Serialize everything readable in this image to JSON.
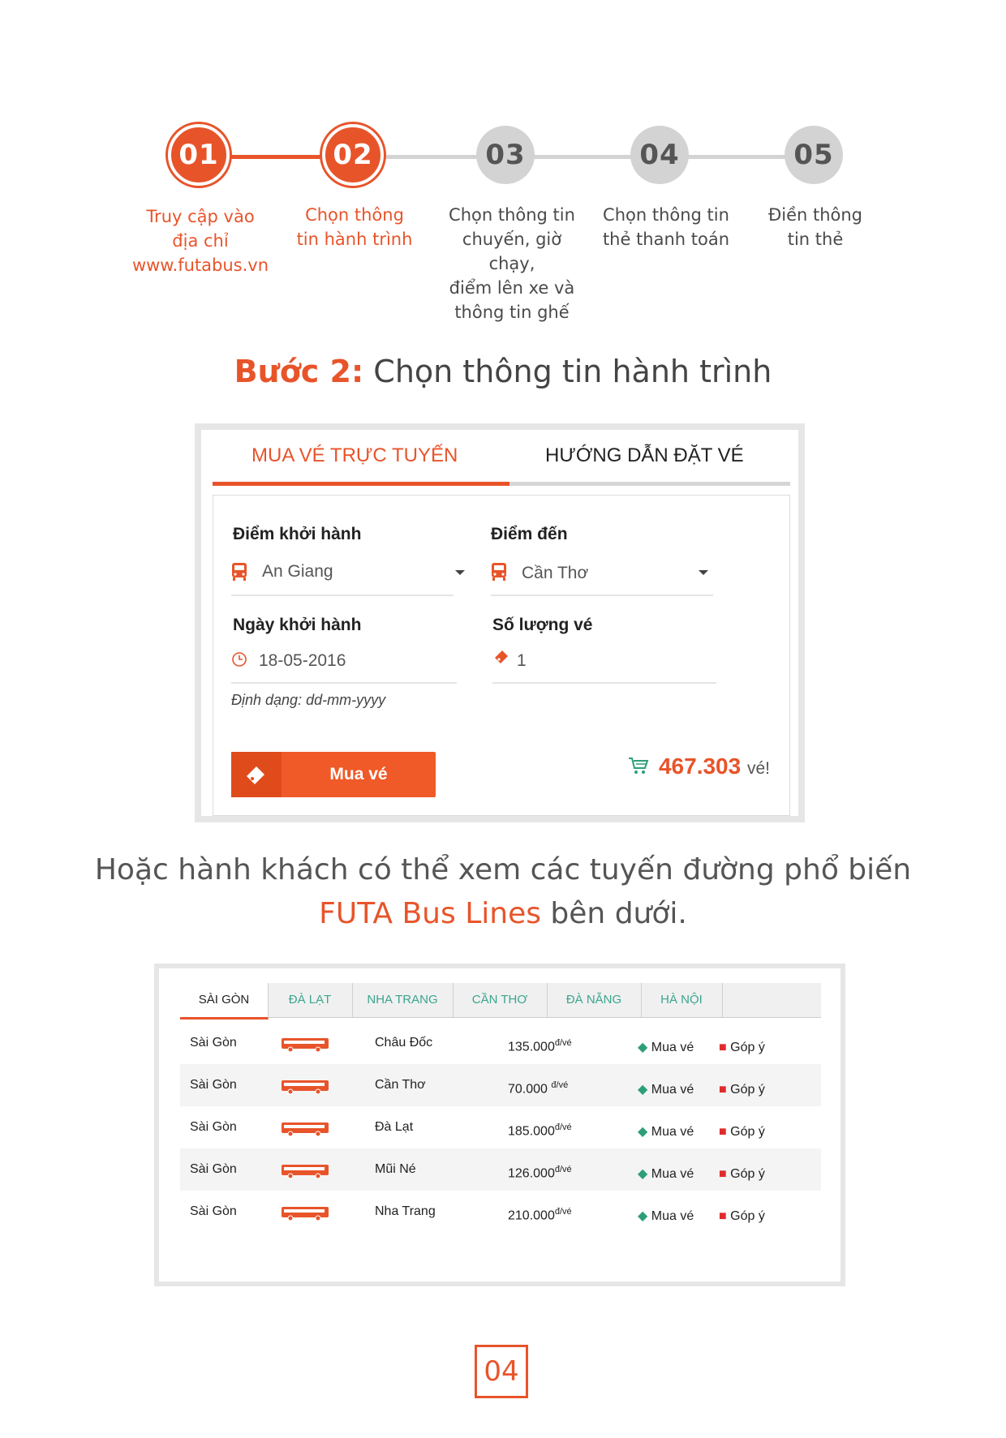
{
  "steps": [
    {
      "num": "01",
      "lines": [
        "Truy cập vào",
        "địa chỉ",
        "www.futabus.vn"
      ]
    },
    {
      "num": "02",
      "lines": [
        "Chọn thông",
        "tin hành trình"
      ]
    },
    {
      "num": "03",
      "lines": [
        "Chọn thông tin",
        "chuyến, giờ chạy,",
        "điểm lên xe và",
        "thông tin ghế"
      ]
    },
    {
      "num": "04",
      "lines": [
        "Chọn thông tin",
        "thẻ thanh toán"
      ]
    },
    {
      "num": "05",
      "lines": [
        "Điền thông",
        "tin thẻ"
      ]
    }
  ],
  "heading": {
    "step": "Bước 2:",
    "text": "Chọn thông tin hành trình"
  },
  "booking": {
    "tab_active": "MUA VÉ TRỰC TUYẾN",
    "tab_other": "HƯỚNG DẪN ĐẶT VÉ",
    "from_label": "Điểm khởi hành",
    "from_value": "An Giang",
    "to_label": "Điểm đến",
    "to_value": "Cần Thơ",
    "date_label": "Ngày khởi hành",
    "date_value": "18-05-2016",
    "date_hint": "Định dạng: dd-mm-yyyy",
    "qty_label": "Số lượng vé",
    "qty_value": "1",
    "buy_label": "Mua vé",
    "count": "467.303",
    "count_unit": "vé!"
  },
  "subtitle": {
    "line1": "Hoặc hành khách có thể xem các tuyến đường phổ biến",
    "brand": "FUTA Bus Lines",
    "rest": " bên dưới."
  },
  "routes": {
    "tabs": [
      "SÀI GÒN",
      "ĐÀ LẠT",
      "NHA TRANG",
      "CẦN THƠ",
      "ĐÀ NẴNG",
      "HÀ NỘI"
    ],
    "unit": "đ/vé",
    "buy": "Mua vé",
    "feedback": "Góp ý",
    "rows": [
      {
        "from": "Sài Gòn",
        "to": "Châu Đốc",
        "price": "135.000"
      },
      {
        "from": "Sài Gòn",
        "to": "Cần Thơ",
        "price": "70.000"
      },
      {
        "from": "Sài Gòn",
        "to": "Đà Lạt",
        "price": "185.000"
      },
      {
        "from": "Sài Gòn",
        "to": "Mũi Né",
        "price": "126.000"
      },
      {
        "from": "Sài Gòn",
        "to": "Nha Trang",
        "price": "210.000"
      }
    ]
  },
  "page_number": "04",
  "colors": {
    "accent": "#e8542a",
    "inactive": "#d3d3d3",
    "tab_green": "#3aa58e",
    "count_green": "#2e9e7a"
  }
}
